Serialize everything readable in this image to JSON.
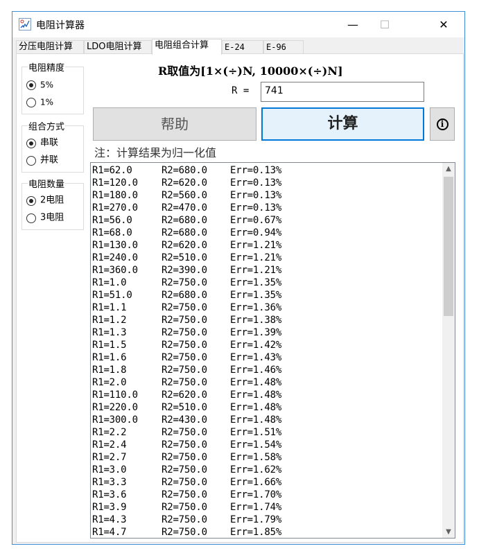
{
  "window": {
    "title": "电阻计算器"
  },
  "titlebar": {
    "minimize": "—",
    "maximize": "☐",
    "close": "✕"
  },
  "tabs": [
    {
      "label": "分压电阻计算"
    },
    {
      "label": "LDO电阻计算"
    },
    {
      "label": "电阻组合计算"
    },
    {
      "label": "E-24"
    },
    {
      "label": "E-96"
    }
  ],
  "precision": {
    "title": "电阻精度",
    "options": [
      "5%",
      "1%"
    ],
    "selected": "5%"
  },
  "combination": {
    "title": "组合方式",
    "options": [
      "串联",
      "并联"
    ],
    "selected": "串联"
  },
  "count": {
    "title": "电阻数量",
    "options": [
      "2电阻",
      "3电阻"
    ],
    "selected": "2电阻"
  },
  "heading": "R取值为[1×(÷)N, 10000×(÷)N]",
  "r_field": {
    "label": "R =",
    "value": "741"
  },
  "buttons": {
    "help": "帮助",
    "calc": "计算",
    "info": "i"
  },
  "note": "注：计算结果为归一化值",
  "results": [
    [
      "R1=62.0",
      "R2=680.0",
      "Err=0.13%"
    ],
    [
      "R1=120.0",
      "R2=620.0",
      "Err=0.13%"
    ],
    [
      "R1=180.0",
      "R2=560.0",
      "Err=0.13%"
    ],
    [
      "R1=270.0",
      "R2=470.0",
      "Err=0.13%"
    ],
    [
      "R1=56.0",
      "R2=680.0",
      "Err=0.67%"
    ],
    [
      "R1=68.0",
      "R2=680.0",
      "Err=0.94%"
    ],
    [
      "R1=130.0",
      "R2=620.0",
      "Err=1.21%"
    ],
    [
      "R1=240.0",
      "R2=510.0",
      "Err=1.21%"
    ],
    [
      "R1=360.0",
      "R2=390.0",
      "Err=1.21%"
    ],
    [
      "R1=1.0",
      "R2=750.0",
      "Err=1.35%"
    ],
    [
      "R1=51.0",
      "R2=680.0",
      "Err=1.35%"
    ],
    [
      "R1=1.1",
      "R2=750.0",
      "Err=1.36%"
    ],
    [
      "R1=1.2",
      "R2=750.0",
      "Err=1.38%"
    ],
    [
      "R1=1.3",
      "R2=750.0",
      "Err=1.39%"
    ],
    [
      "R1=1.5",
      "R2=750.0",
      "Err=1.42%"
    ],
    [
      "R1=1.6",
      "R2=750.0",
      "Err=1.43%"
    ],
    [
      "R1=1.8",
      "R2=750.0",
      "Err=1.46%"
    ],
    [
      "R1=2.0",
      "R2=750.0",
      "Err=1.48%"
    ],
    [
      "R1=110.0",
      "R2=620.0",
      "Err=1.48%"
    ],
    [
      "R1=220.0",
      "R2=510.0",
      "Err=1.48%"
    ],
    [
      "R1=300.0",
      "R2=430.0",
      "Err=1.48%"
    ],
    [
      "R1=2.2",
      "R2=750.0",
      "Err=1.51%"
    ],
    [
      "R1=2.4",
      "R2=750.0",
      "Err=1.54%"
    ],
    [
      "R1=2.7",
      "R2=750.0",
      "Err=1.58%"
    ],
    [
      "R1=3.0",
      "R2=750.0",
      "Err=1.62%"
    ],
    [
      "R1=3.3",
      "R2=750.0",
      "Err=1.66%"
    ],
    [
      "R1=3.6",
      "R2=750.0",
      "Err=1.70%"
    ],
    [
      "R1=3.9",
      "R2=750.0",
      "Err=1.74%"
    ],
    [
      "R1=4.3",
      "R2=750.0",
      "Err=1.79%"
    ],
    [
      "R1=4.7",
      "R2=750.0",
      "Err=1.85%"
    ]
  ],
  "scroll": {
    "up": "▲",
    "down": "▼",
    "position_fraction": 0.0
  }
}
